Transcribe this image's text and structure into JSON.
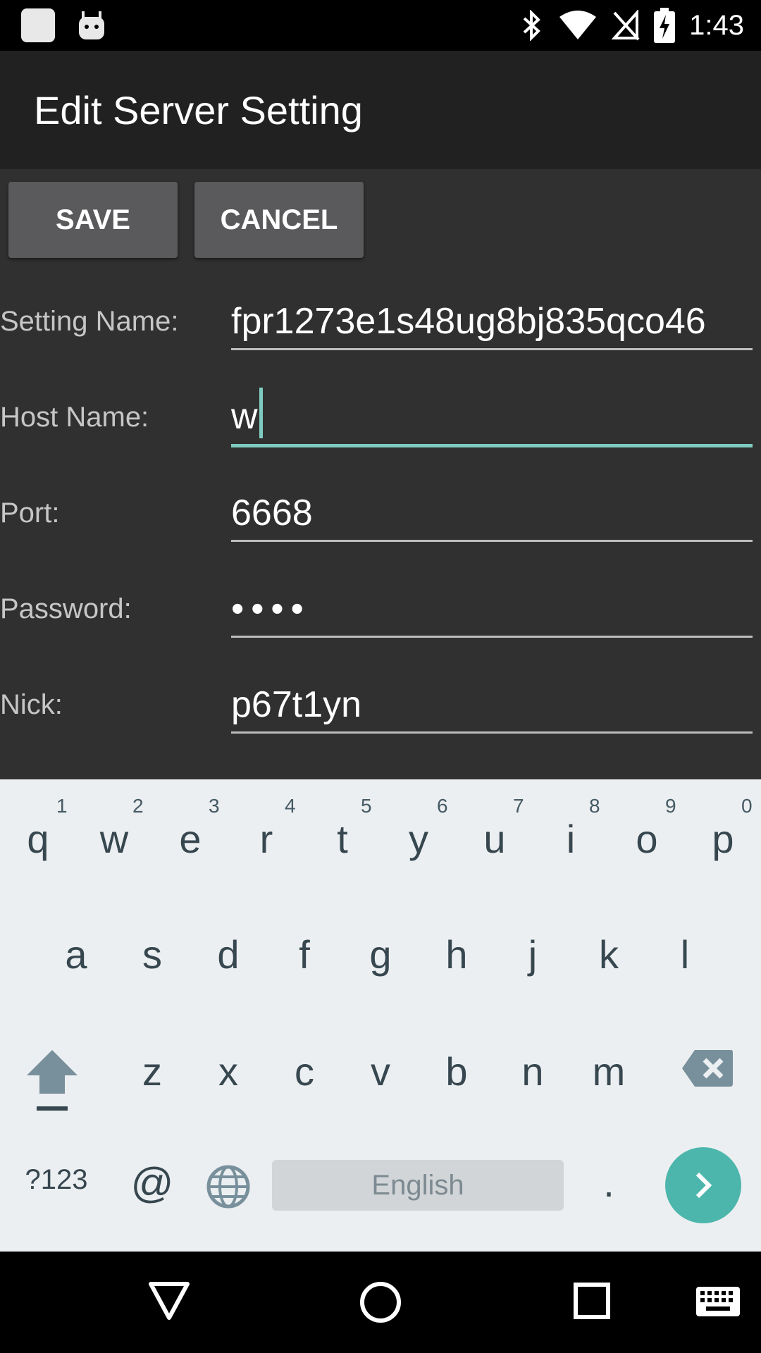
{
  "status_bar": {
    "time": "1:43",
    "icons": [
      "bluetooth-icon",
      "wifi-icon",
      "no-sim-icon",
      "battery-charging-icon"
    ]
  },
  "app_bar": {
    "title": "Edit Server Setting"
  },
  "actions": {
    "save_label": "SAVE",
    "cancel_label": "CANCEL"
  },
  "form": {
    "setting_name": {
      "label": "Setting Name:",
      "value": "fpr1273e1s48ug8bj835qco46"
    },
    "host_name": {
      "label": "Host Name:",
      "value": "w"
    },
    "port": {
      "label": "Port:",
      "value": "6668"
    },
    "password": {
      "label": "Password:",
      "value": "••••"
    },
    "nick": {
      "label": "Nick:",
      "value": "p67t1yn"
    }
  },
  "keyboard": {
    "row1": [
      "q",
      "w",
      "e",
      "r",
      "t",
      "y",
      "u",
      "i",
      "o",
      "p"
    ],
    "row1_hints": [
      "1",
      "2",
      "3",
      "4",
      "5",
      "6",
      "7",
      "8",
      "9",
      "0"
    ],
    "row2": [
      "a",
      "s",
      "d",
      "f",
      "g",
      "h",
      "j",
      "k",
      "l"
    ],
    "row3": [
      "z",
      "x",
      "c",
      "v",
      "b",
      "n",
      "m"
    ],
    "symbols_label": "?123",
    "at_label": "@",
    "space_label": "English",
    "period_label": ".",
    "accent_color": "#4db6ac"
  },
  "nav_bar": {
    "icons": [
      "back-icon",
      "home-icon",
      "recents-icon",
      "keyboard-switch-icon"
    ]
  }
}
